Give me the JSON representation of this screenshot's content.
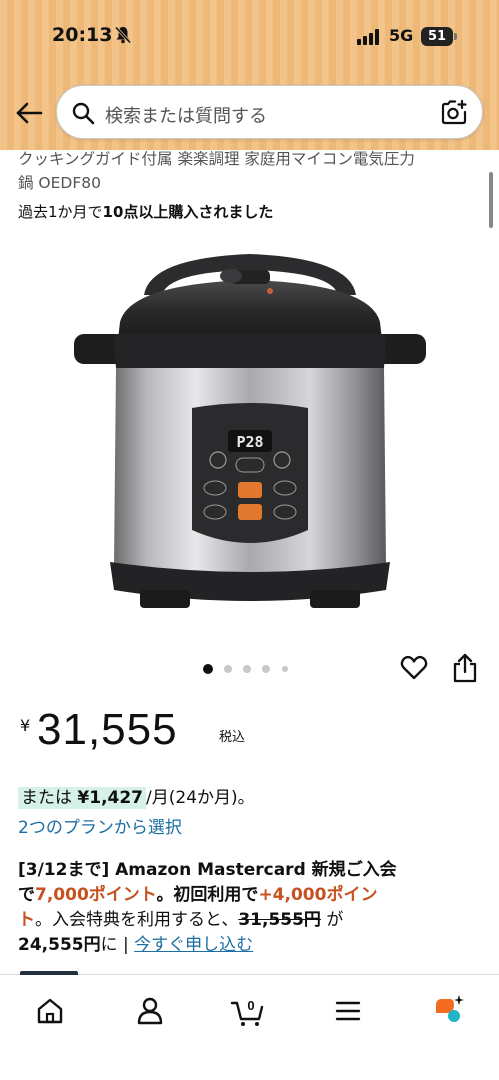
{
  "status_bar": {
    "time": "20:13",
    "network": "5G",
    "battery": "51"
  },
  "search": {
    "placeholder": "検索または質問する"
  },
  "product": {
    "title_line1": "クッキングガイド付属 楽楽調理 家庭用マイコン電気圧力",
    "title_line2": "鍋 OEDF80",
    "bought_prefix": "過去1か月で",
    "bought_highlight": "10点以上購入されました",
    "panel_display": "P28",
    "image_count": 5,
    "active_image": 1
  },
  "price": {
    "currency": "¥",
    "amount": "31,555",
    "tax_label": "税込"
  },
  "installment": {
    "prefix": "または",
    "amount": "¥1,427",
    "suffix": "/月(24か月)。",
    "plans_link": "2つのプランから選択"
  },
  "promo": {
    "p1": "[3/12まで] Amazon Mastercard 新規ご入会",
    "p2": "で",
    "p3": "7,000ポイント",
    "p4": "。初回利用で",
    "p5": "+4,000ポイン",
    "p6": "ト",
    "p7": "。入会特典を利用すると、",
    "p8": "31,555円",
    "p9": " が",
    "p10": "24,555円",
    "p11": "に | ",
    "link": "今すぐ申し込む"
  },
  "bottom_nav": {
    "items": [
      "home-icon",
      "account-icon",
      "cart-icon",
      "menu-icon",
      "rufus-icon"
    ],
    "cart_count": "0"
  },
  "colors": {
    "accent_link": "#1c6ea4",
    "promo_red": "#c7511f",
    "install_highlight": "#d5f1e8",
    "header_bg": "#f2c48a"
  }
}
